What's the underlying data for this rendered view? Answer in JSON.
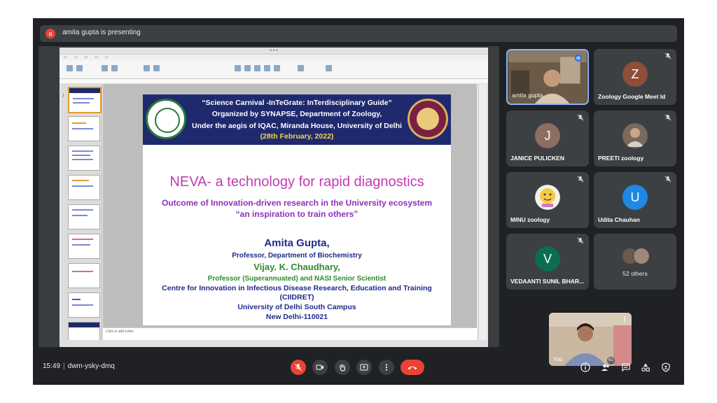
{
  "presenting": {
    "text": "amita gupta is presenting",
    "initial": "a"
  },
  "slide": {
    "header_line1": "“Science Carnival -InTeGrate: InTerdisciplinary Guide”",
    "header_line2": "Organized by SYNAPSE, Department of Zoology,",
    "header_line3": "Under the aegis of IQAC, Miranda House, University of Delhi",
    "header_date": "(28th February, 2022)",
    "title": "NEVA- a technology for rapid diagnostics",
    "subtitle1": "Outcome of Innovation-driven research in the University ecosystem",
    "subtitle2": "“an inspiration to train others”",
    "presenter1_name": "Amita Gupta,",
    "presenter1_role": "Professor, Department of Biochemistry",
    "presenter2_name": "Vijay. K. Chaudhary,",
    "presenter2_role": "Professor (Superannuated) and NASI Senior Scientist",
    "centre": "Centre for Innovation in Infectious Disease Research, Education and Training",
    "centre_abbr": "(CIIDRET)",
    "university": "University of Delhi South Campus",
    "city": "New Delhi-110021"
  },
  "app": {
    "notes_placeholder": "Click to add notes"
  },
  "participants": [
    {
      "name": "amita gupta",
      "type": "video"
    },
    {
      "name": "Zoology Google Meet Id",
      "initial": "Z",
      "color": "#8d4e3a"
    },
    {
      "name": "JANICE PULICKEN",
      "initial": "J",
      "color": "#8d6e63"
    },
    {
      "name": "PREETI zoology",
      "type": "photo"
    },
    {
      "name": "MINU zoology",
      "type": "emoji"
    },
    {
      "name": "Udita Chauhan",
      "initial": "U",
      "color": "#1e88e5"
    },
    {
      "name": "VEDAANTI SUNIL BHAR...",
      "initial": "V",
      "color": "#0b6e4f"
    },
    {
      "others": "52 others"
    }
  ],
  "self": {
    "label": "You"
  },
  "meeting": {
    "time": "15:49",
    "code": "dwm-ysky-dmq",
    "participant_count": "61"
  },
  "colors": {
    "accent": "#8ab4f8",
    "danger": "#ea4335",
    "tile": "#3c4043",
    "bg": "#202124"
  }
}
